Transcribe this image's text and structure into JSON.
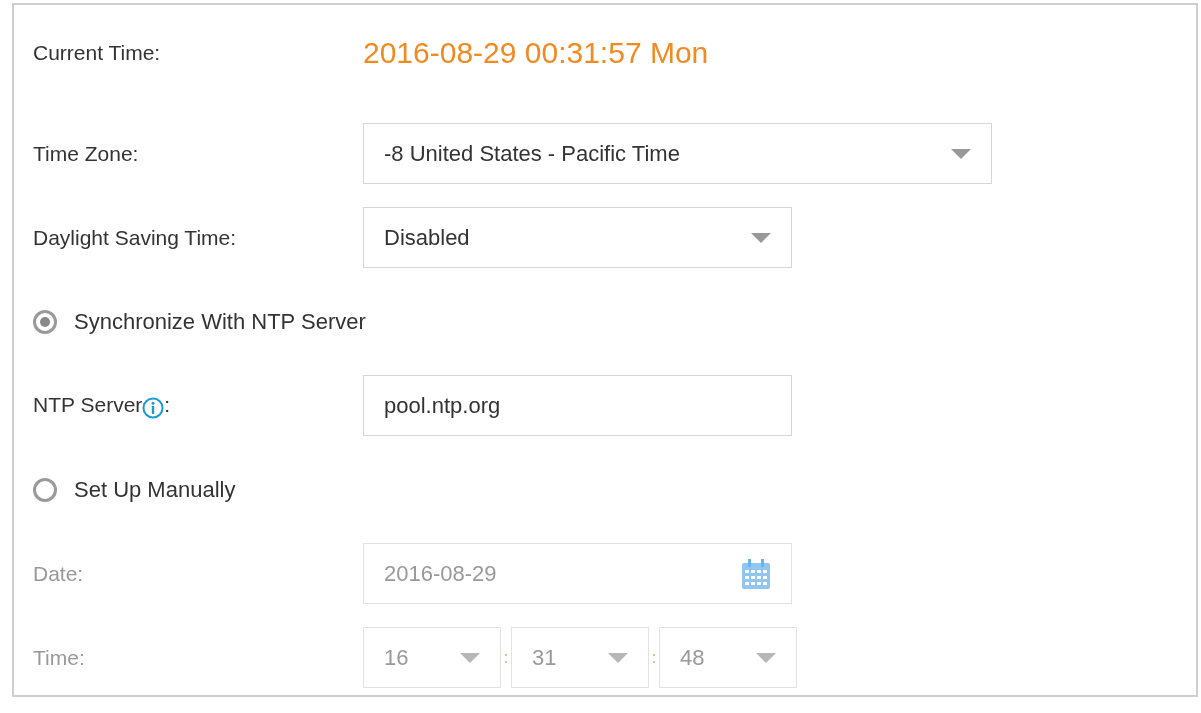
{
  "current_time": {
    "label": "Current Time:",
    "value": "2016-08-29 00:31:57 Mon"
  },
  "time_zone": {
    "label": "Time Zone:",
    "value": "-8 United States - Pacific Time"
  },
  "daylight_saving": {
    "label": "Daylight Saving Time:",
    "value": "Disabled"
  },
  "sync_modes": [
    {
      "label": "Synchronize With NTP Server",
      "selected": true,
      "fields": [
        {
          "kind": "text",
          "label": "NTP Server",
          "label_suffix": ":",
          "info": true,
          "value": "pool.ntp.org",
          "disabled": false
        }
      ]
    },
    {
      "label": "Set Up Manually",
      "selected": false,
      "fields": [
        {
          "kind": "date",
          "label": "Date:",
          "value": "2016-08-29",
          "disabled": true
        },
        {
          "kind": "time",
          "label": "Time:",
          "parts": [
            "16",
            "31",
            "48"
          ],
          "separators": [
            ":",
            ":"
          ],
          "disabled": true
        }
      ]
    }
  ]
}
